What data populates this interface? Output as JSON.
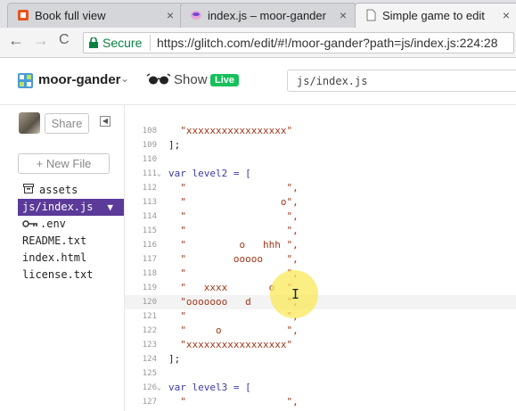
{
  "tabs": [
    {
      "title": "Book full view",
      "favicon": "book-icon",
      "close": "×",
      "active": false
    },
    {
      "title": "index.js – moor-gander",
      "favicon": "glitch-fish-icon",
      "close": "×",
      "active": true
    },
    {
      "title": "Simple game to edit",
      "favicon": "page-icon",
      "close": "×",
      "active": false
    }
  ],
  "toolbar": {
    "back": "←",
    "forward": "→",
    "reload": "C",
    "secure_label": "Secure",
    "url": "https://glitch.com/edit/#!/moor-gander?path=js/index.js:224:28"
  },
  "header": {
    "project_name": "moor-gander",
    "show_label": "Show",
    "live_badge": "Live",
    "file_path": "js/index.js"
  },
  "sidebar": {
    "share_label": "Share",
    "collapse_glyph": "◀",
    "new_file_label": "+ New File",
    "files": [
      {
        "name": "assets",
        "icon": "assets-box-icon",
        "selected": false
      },
      {
        "name": "js/index.js",
        "icon": "",
        "selected": true
      },
      {
        "name": ".env",
        "icon": "key-icon",
        "selected": false
      },
      {
        "name": "README.txt",
        "icon": "",
        "selected": false
      },
      {
        "name": "index.html",
        "icon": "",
        "selected": false
      },
      {
        "name": "license.txt",
        "icon": "",
        "selected": false
      }
    ]
  },
  "editor": {
    "current_line": 120,
    "lines": [
      {
        "n": "108",
        "fold": "",
        "text": "  \"xxxxxxxxxxxxxxxxx\""
      },
      {
        "n": "109",
        "fold": "",
        "text": "];"
      },
      {
        "n": "110",
        "fold": "",
        "text": ""
      },
      {
        "n": "111",
        "fold": "⌄",
        "text": "var level2 = ["
      },
      {
        "n": "112",
        "fold": "",
        "text": "  \"                 \","
      },
      {
        "n": "113",
        "fold": "",
        "text": "  \"                o\","
      },
      {
        "n": "114",
        "fold": "",
        "text": "  \"                 \","
      },
      {
        "n": "115",
        "fold": "",
        "text": "  \"                 \","
      },
      {
        "n": "116",
        "fold": "",
        "text": "  \"         o   hhh \","
      },
      {
        "n": "117",
        "fold": "",
        "text": "  \"        ooooo    \","
      },
      {
        "n": "118",
        "fold": "",
        "text": "  \"                 \","
      },
      {
        "n": "119",
        "fold": "",
        "text": "  \"   xxxx       o  \","
      },
      {
        "n": "120",
        "fold": "",
        "text": "  \"ooooooo   d      \","
      },
      {
        "n": "121",
        "fold": "",
        "text": "  \"                 \","
      },
      {
        "n": "122",
        "fold": "",
        "text": "  \"     o           \","
      },
      {
        "n": "123",
        "fold": "",
        "text": "  \"xxxxxxxxxxxxxxxxx\""
      },
      {
        "n": "124",
        "fold": "",
        "text": "];"
      },
      {
        "n": "125",
        "fold": "",
        "text": ""
      },
      {
        "n": "126",
        "fold": "⌄",
        "text": "var level3 = ["
      },
      {
        "n": "127",
        "fold": "",
        "text": "  \"                 \","
      }
    ]
  }
}
